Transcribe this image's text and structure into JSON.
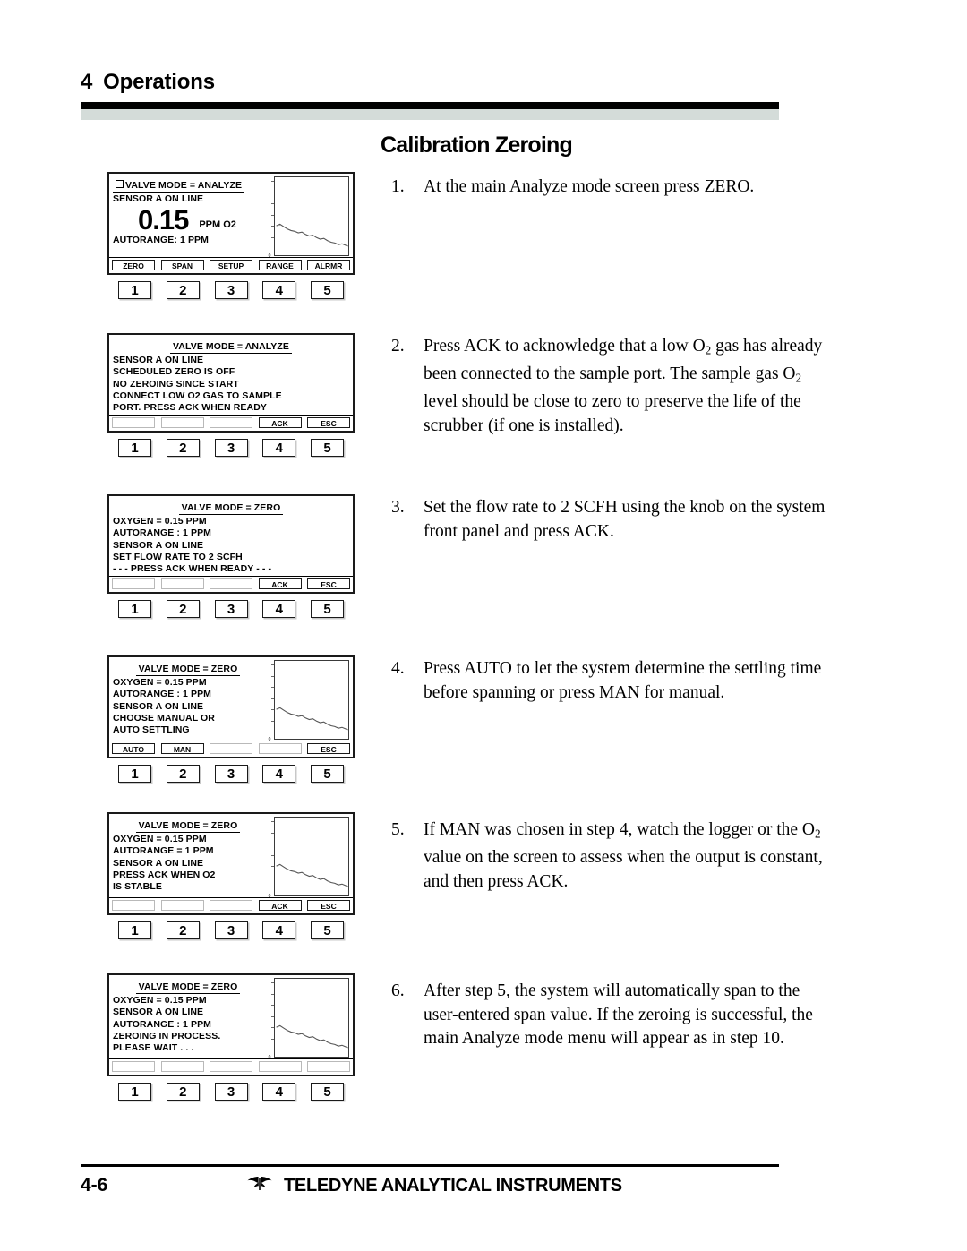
{
  "header": {
    "chapter_number": "4",
    "chapter_title": "Operations"
  },
  "section_title": "Calibration Zeroing",
  "steps": [
    {
      "number": "1.",
      "text": "At the main Analyze mode screen press ZERO."
    },
    {
      "number": "2.",
      "text_parts": [
        "Press ACK to acknowledge that a low O",
        "2",
        " gas has already been connected to the sample port. The sample gas O",
        "2",
        " level should be close to zero to preserve the life of the scrubber (if one is installed)."
      ]
    },
    {
      "number": "3.",
      "text": "Set the flow rate to 2 SCFH using the knob on the system front panel and press ACK."
    },
    {
      "number": "4.",
      "text": "Press AUTO to let the system determine the settling time before spanning or press MAN for manual."
    },
    {
      "number": "5.",
      "text_parts": [
        "If MAN was chosen in step 4, watch the logger or the O",
        "2",
        " value on the screen to assess when the output is constant, and then press ACK."
      ]
    },
    {
      "number": "6.",
      "text": "After step 5, the system will automatically span to the user-entered span value. If the zeroing is successful, the main Analyze mode menu will appear as in step 10."
    }
  ],
  "panels": [
    {
      "id": "panel-analyze-main",
      "has_valve_icon": true,
      "title": "VALVE  MODE = ANALYZE",
      "title_centered": false,
      "lines": [
        "SENSOR  A  ON  LINE"
      ],
      "reading": {
        "value": "0.15",
        "units": "PPM O2"
      },
      "footer_line": "AUTORANGE: 1  PPM",
      "has_graph": true,
      "graph_zero_label": "0",
      "softkeys": [
        "ZERO",
        "SPAN",
        "SETUP",
        "RANGE",
        "ALRMR"
      ],
      "keys": [
        "1",
        "2",
        "3",
        "4",
        "5"
      ]
    },
    {
      "id": "panel-connect-gas",
      "has_valve_icon": false,
      "title": "VALVE  MODE = ANALYZE",
      "title_centered": true,
      "lines": [
        "SENSOR  A  ON  LINE",
        "SCHEDULED  ZERO  IS  OFF",
        "NO  ZEROING  SINCE  START",
        "CONNECT  LOW  O2  GAS  TO  SAMPLE",
        "PORT.   PRESS  ACK  WHEN  READY"
      ],
      "has_graph": false,
      "softkeys": [
        "",
        "",
        "",
        "ACK",
        "ESC"
      ],
      "keys": [
        "1",
        "2",
        "3",
        "4",
        "5"
      ]
    },
    {
      "id": "panel-set-flow",
      "has_valve_icon": false,
      "title": "VALVE  MODE = ZERO",
      "title_centered": true,
      "lines": [
        "OXYGEN = 0.15 PPM",
        "AUTORANGE : 1 PPM",
        "SENSOR  A  ON  LINE",
        "   SET  FLOW  RATE  TO  2  SCFH",
        "- - -  PRESS  ACK  WHEN  READY  - - -"
      ],
      "has_graph": false,
      "softkeys": [
        "",
        "",
        "",
        "ACK",
        "ESC"
      ],
      "keys": [
        "1",
        "2",
        "3",
        "4",
        "5"
      ]
    },
    {
      "id": "panel-choose-settling",
      "has_valve_icon": false,
      "title": "VALVE  MODE = ZERO",
      "title_centered": true,
      "lines": [
        "OXYGEN  =    0.15  PPM",
        "AUTORANGE : 1 PPM",
        "SENSOR  A  ON  LINE",
        "CHOOSE  MANUAL  OR",
        "AUTO  SETTLING"
      ],
      "has_graph": true,
      "graph_zero_label": "0",
      "softkeys": [
        "AUTO",
        "MAN",
        "",
        "",
        "ESC"
      ],
      "keys": [
        "1",
        "2",
        "3",
        "4",
        "5"
      ]
    },
    {
      "id": "panel-press-ack-stable",
      "has_valve_icon": false,
      "title": "VALVE  MODE = ZERO",
      "title_centered": true,
      "lines": [
        "OXYGEN  =    0.15  PPM",
        "AUTORANGE = 1 PPM",
        "SENSOR  A  ON  LINE",
        "PRESS ACK WHEN O2",
        "IS STABLE"
      ],
      "has_graph": true,
      "graph_zero_label": "0",
      "softkeys": [
        "",
        "",
        "",
        "ACK",
        "ESC"
      ],
      "keys": [
        "1",
        "2",
        "3",
        "4",
        "5"
      ]
    },
    {
      "id": "panel-zeroing-in-process",
      "has_valve_icon": false,
      "title": "VALVE  MODE = ZERO",
      "title_centered": true,
      "lines": [
        "OXYGEN = 0.15 PPM",
        "SENSOR  A  ON  LINE",
        "AUTORANGE : 1 PPM",
        "ZEROING  IN  PROCESS.",
        "PLEASE  WAIT . . ."
      ],
      "has_graph": true,
      "graph_zero_label": "0",
      "softkeys": [
        "",
        "",
        "",
        "",
        ""
      ],
      "keys": [
        "1",
        "2",
        "3",
        "4",
        "5"
      ]
    }
  ],
  "footer": {
    "page_number": "4-6",
    "company": "TELEDYNE ANALYTICAL INSTRUMENTS"
  },
  "colors": {
    "rule_black": "#000000",
    "rule_gray": "#d4dcd9",
    "ink": "#000000",
    "disabled_key_border": "#b9b9b9"
  }
}
